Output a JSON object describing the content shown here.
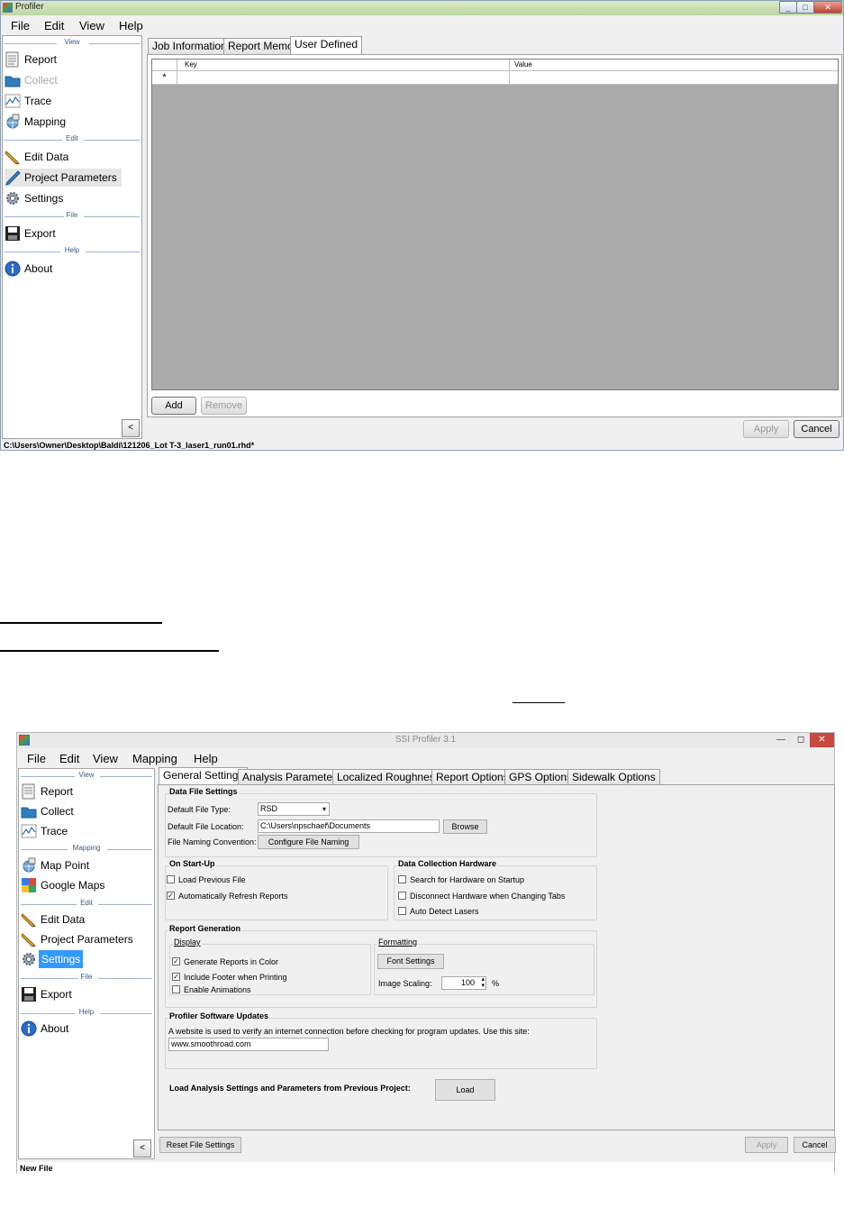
{
  "window1": {
    "title": "Profiler",
    "controls": {
      "minimize": "_",
      "maximize": "□",
      "close": "✕"
    },
    "menu": [
      "File",
      "Edit",
      "View",
      "Help"
    ],
    "sidebar": {
      "sections": [
        "View",
        "Edit",
        "File",
        "Help"
      ],
      "items": [
        "Report",
        "Collect",
        "Trace",
        "Mapping",
        "Edit Data",
        "Project Parameters",
        "Settings",
        "Export",
        "About"
      ],
      "collapse": "<"
    },
    "tabs": [
      "Job Information",
      "Report Memo",
      "User Defined"
    ],
    "grid": {
      "columns": [
        "Key",
        "Value"
      ],
      "new_row_marker": "*"
    },
    "buttons": {
      "add": "Add",
      "remove": "Remove",
      "apply": "Apply",
      "cancel": "Cancel"
    },
    "status": "C:\\Users\\Owner\\Desktop\\Baldi\\121206_Lot T-3_laser1_run01.rhd*"
  },
  "window2": {
    "title": "SSI Profiler 3.1",
    "controls": {
      "minimize": "—",
      "maximize": "◻",
      "close": "✕"
    },
    "menu": [
      "File",
      "Edit",
      "View",
      "Mapping",
      "Help"
    ],
    "sidebar": {
      "sections": [
        "View",
        "Mapping",
        "Edit",
        "File",
        "Help"
      ],
      "items": [
        "Report",
        "Collect",
        "Trace",
        "Map Point",
        "Google Maps",
        "Edit Data",
        "Project Parameters",
        "Settings",
        "Export",
        "About"
      ],
      "collapse": "<"
    },
    "tabs": [
      "General Settings",
      "Analysis Parameters",
      "Localized Roughness",
      "Report Options",
      "GPS Options",
      "Sidewalk Options"
    ],
    "data_file": {
      "group": "Data File Settings",
      "type_label": "Default File Type:",
      "type_value": "RSD",
      "location_label": "Default File Location:",
      "location_value": "C:\\Users\\npschaef\\Documents",
      "browse": "Browse",
      "naming_label": "File Naming Convention:",
      "naming_button": "Configure File Naming"
    },
    "startup": {
      "group": "On Start-Up",
      "load_previous": "Load Previous File",
      "auto_refresh": "Automatically Refresh Reports"
    },
    "hardware": {
      "group": "Data Collection Hardware",
      "search": "Search for Hardware on Startup",
      "disconnect": "Disconnect Hardware when Changing Tabs",
      "auto_detect": "Auto Detect Lasers"
    },
    "report_gen": {
      "group": "Report Generation",
      "display": "Display",
      "color": "Generate Reports in Color",
      "footer": "Include Footer when Printing",
      "animations": "Enable Animations",
      "formatting": "Formatting",
      "font_settings": "Font Settings",
      "scaling_label": "Image Scaling:",
      "scaling_value": "100",
      "percent": "%"
    },
    "updates": {
      "group": "Profiler Software Updates",
      "text": "A website is used to verify an internet connection before checking for program updates. Use this site:",
      "site": "www.smoothroad.com"
    },
    "load": {
      "label": "Load Analysis Settings and Parameters from Previous Project:",
      "button": "Load"
    },
    "buttons": {
      "reset": "Reset File Settings",
      "apply": "Apply",
      "cancel": "Cancel"
    },
    "status": "New File",
    "checked": {
      "load_previous": false,
      "auto_refresh": true,
      "search": false,
      "disconnect": false,
      "auto_detect": false,
      "color": true,
      "footer": true,
      "animations": false
    }
  }
}
